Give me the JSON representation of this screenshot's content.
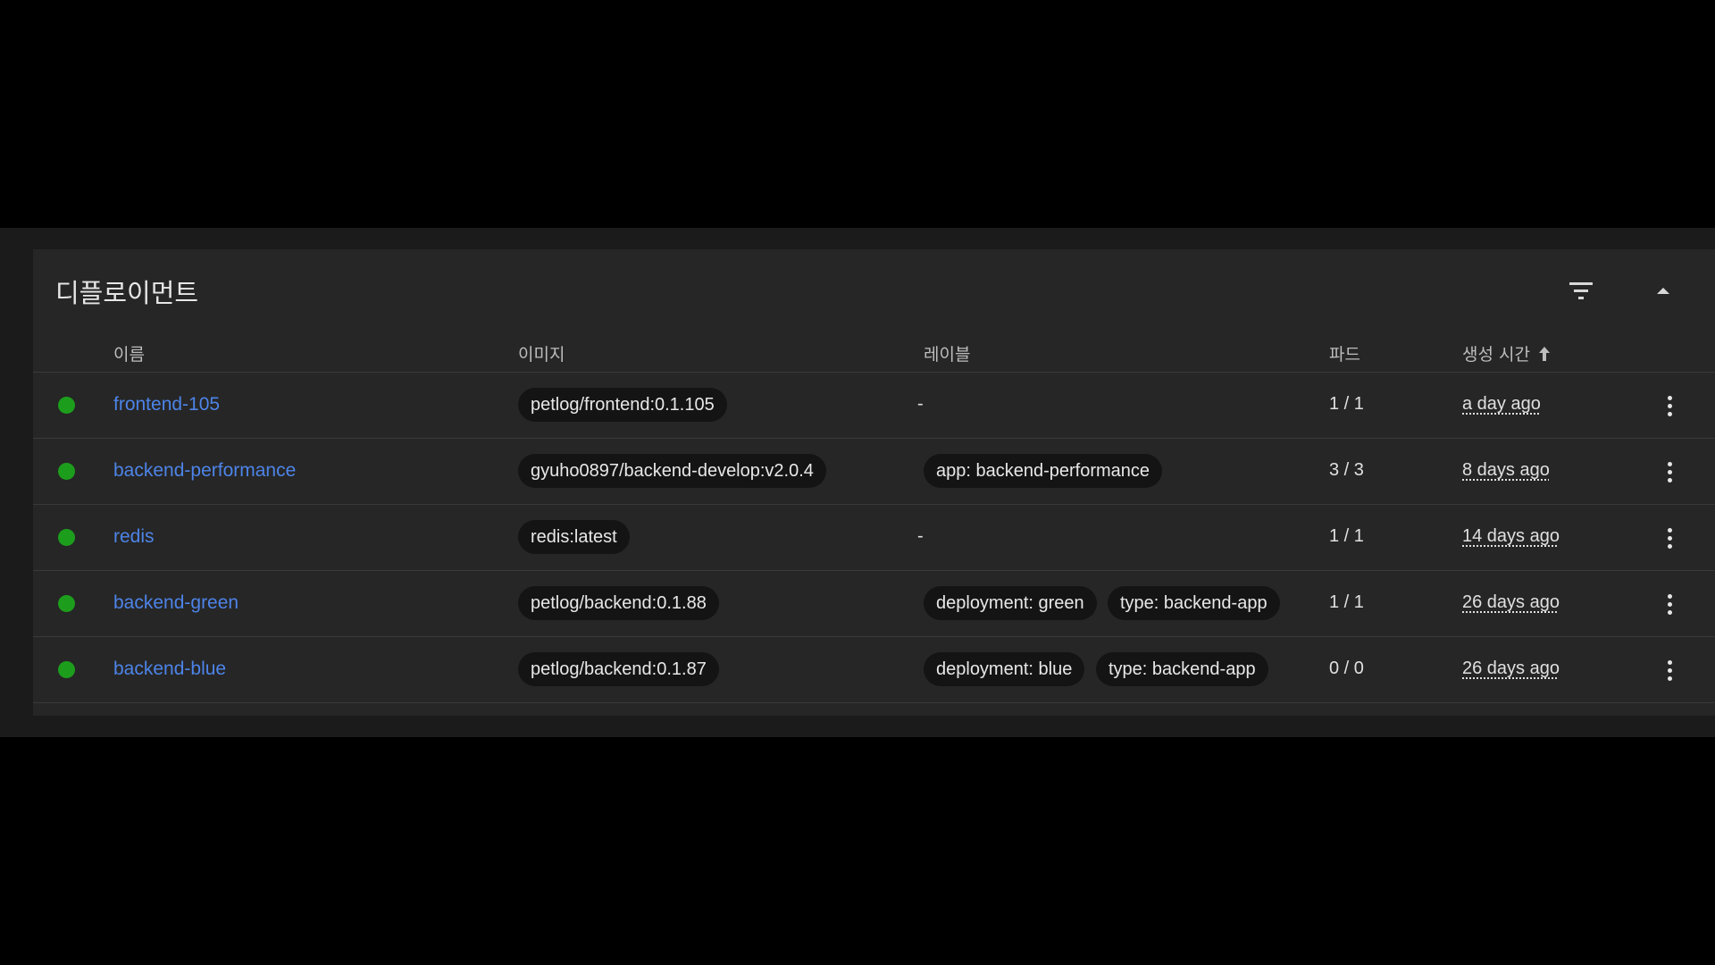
{
  "card": {
    "title": "디플로이먼트"
  },
  "icons": {
    "filter": "filter-icon",
    "collapse": "chevron-up-icon",
    "more": "more-vertical-icon",
    "sort": "arrow-up-icon"
  },
  "columns": {
    "name": "이름",
    "image": "이미지",
    "labels": "레이블",
    "pods": "파드",
    "created": "생성 시간"
  },
  "colors": {
    "status_ok": "#1c9e1c",
    "link": "#4d84e8"
  },
  "rows": [
    {
      "name": "frontend-105",
      "image": "petlog/frontend:0.1.105",
      "labels": [],
      "labels_empty": "-",
      "pods": "1 / 1",
      "created": "a day ago"
    },
    {
      "name": "backend-performance",
      "image": "gyuho0897/backend-develop:v2.0.4",
      "labels": [
        "app: backend-performance"
      ],
      "labels_empty": "",
      "pods": "3 / 3",
      "created": "8 days ago"
    },
    {
      "name": "redis",
      "image": "redis:latest",
      "labels": [],
      "labels_empty": "-",
      "pods": "1 / 1",
      "created": "14 days ago"
    },
    {
      "name": "backend-green",
      "image": "petlog/backend:0.1.88",
      "labels": [
        "deployment: green",
        "type: backend-app"
      ],
      "labels_empty": "",
      "pods": "1 / 1",
      "created": "26 days ago"
    },
    {
      "name": "backend-blue",
      "image": "petlog/backend:0.1.87",
      "labels": [
        "deployment: blue",
        "type: backend-app"
      ],
      "labels_empty": "",
      "pods": "0 / 0",
      "created": "26 days ago"
    }
  ]
}
